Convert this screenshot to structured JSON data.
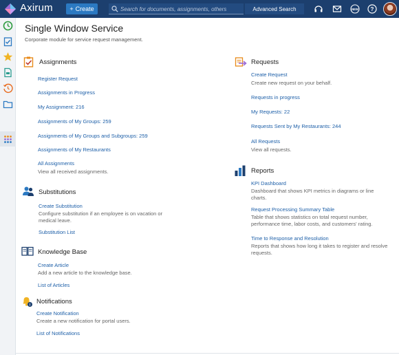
{
  "topbar": {
    "app_name": "Axirum",
    "create_label": "Create",
    "search_placeholder": "Search for documents, assignments, others",
    "advanced_search_label": "Advanced Search",
    "bg_color": "#1c3f6e"
  },
  "sidebar": {
    "icons": [
      "clock-icon",
      "checklist-icon",
      "star-icon",
      "document-icon",
      "history-icon",
      "folder-icon",
      "apps-grid-icon"
    ]
  },
  "page": {
    "title": "Single Window Service",
    "subtitle": "Corporate module for service request management."
  },
  "assignments": {
    "title": "Assignments",
    "links": [
      "Register Request",
      "Assignments in Progress",
      "My Assignment: 216",
      "Assignments of My Groups: 259",
      "Assignments of My Groups and Subgroups: 259",
      "Assignments of My Restaurants",
      "All Assignments"
    ],
    "all_desc": "View all received assignments."
  },
  "substitutions": {
    "title": "Substitutions",
    "create_link": "Create Substitution",
    "create_desc": "Configure substitution if an employee is on vacation or medical leave.",
    "list_link": "Substitution List"
  },
  "knowledge": {
    "title": "Knowledge Base",
    "create_link": "Create Article",
    "create_desc": "Add a new article to the knowledge base.",
    "list_link": "List of Articles"
  },
  "notifications": {
    "title": "Notifications",
    "create_link": "Create Notification",
    "create_desc": "Create a new notification for portal users.",
    "list_link": "List of Notifications"
  },
  "requests": {
    "title": "Requests",
    "create_link": "Create Request",
    "create_desc": "Create new request on your behalf.",
    "links": [
      "Requests in progress",
      "My Requests: 22",
      "Requests Sent by My Restaurants: 244"
    ],
    "all_link": "All Requests",
    "all_desc": "View all requests."
  },
  "reports": {
    "title": "Reports",
    "kpi_link": "KPI Dashboard",
    "kpi_desc": "Dashboard that shows KPI metrics in diagrams or line charts.",
    "summary_link": "Request Processing Summary Table",
    "summary_desc": "Table that shows statistics on total request number, performance time, labor costs, and customers' rating.",
    "time_link": "Time to Response and Resolution",
    "time_desc": "Reports that shows how long it takes to register and resolve requests."
  },
  "colors": {
    "link": "#1d5fa8",
    "accent_orange": "#e88a1a",
    "accent_blue": "#2b79c2"
  }
}
